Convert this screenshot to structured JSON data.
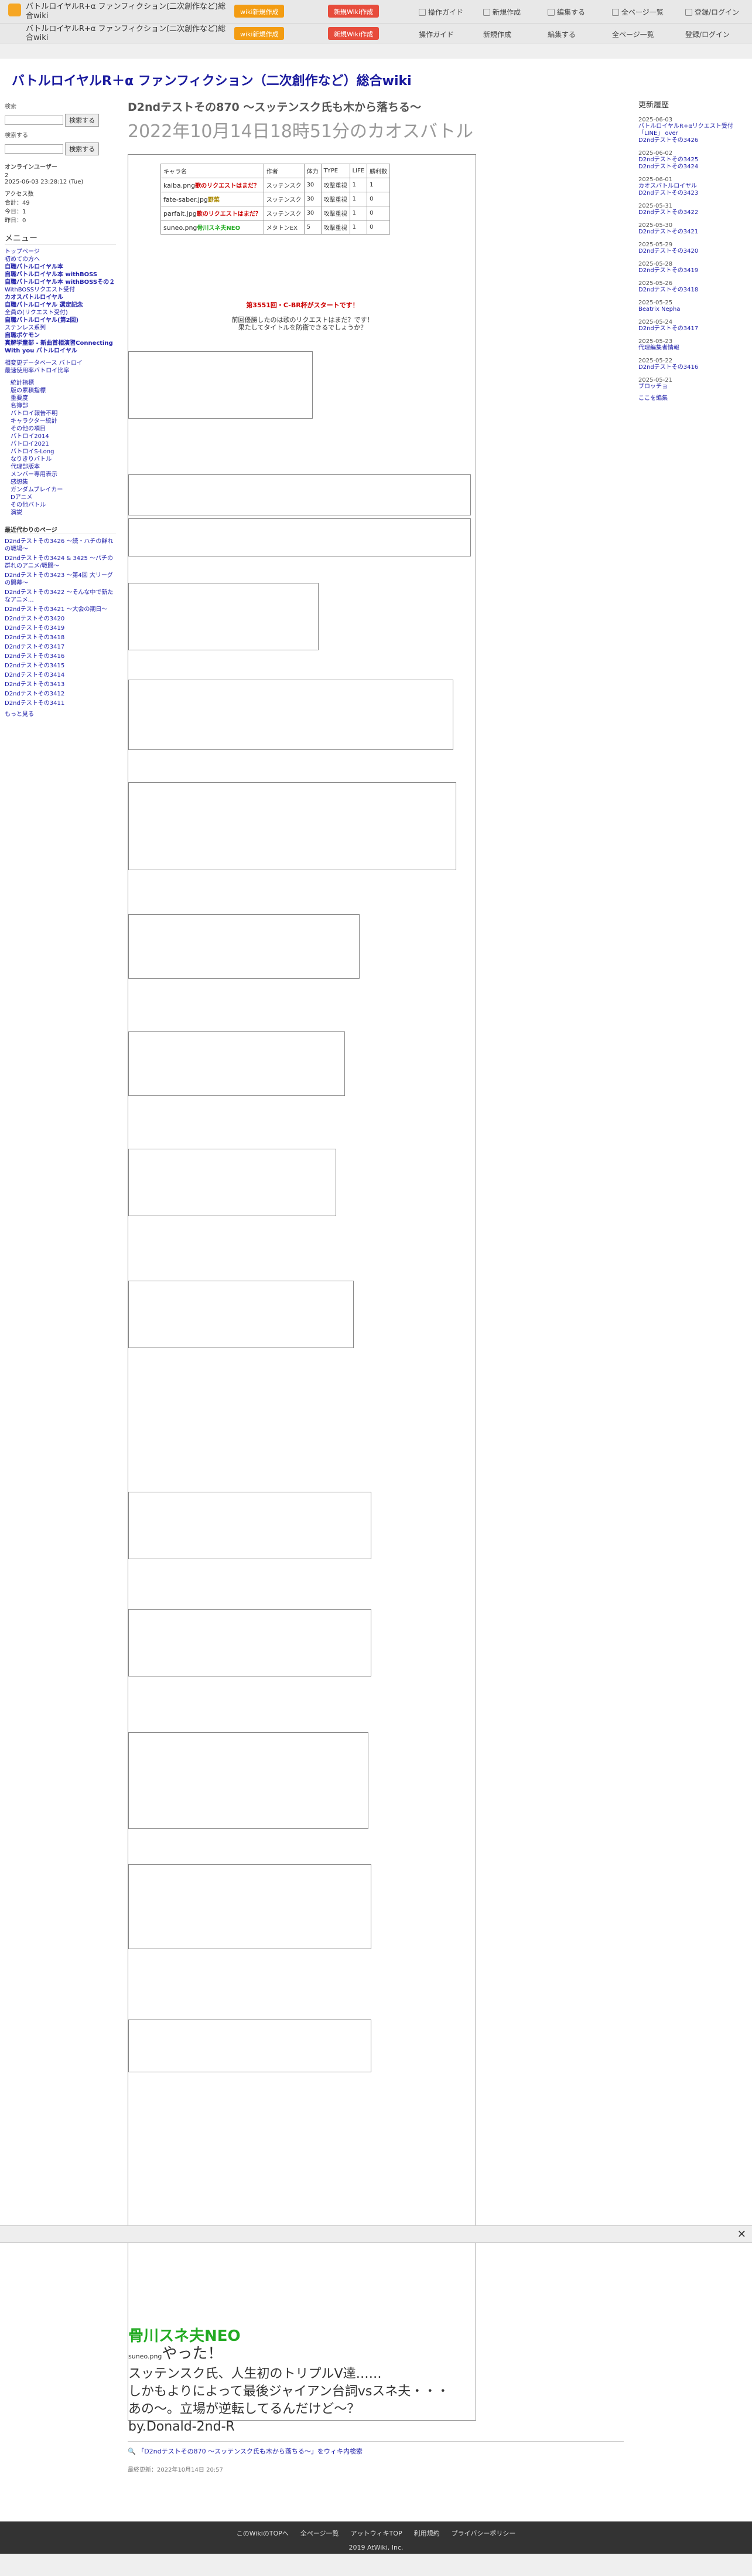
{
  "topbar": {
    "title": "バトルロイヤルR+α ファンフィクション(二次創作など)総合wiki",
    "wiki_create": "wiki新規作成",
    "reply_new": "新規Wiki作成",
    "items": [
      "操作ガイド",
      "新規作成",
      "編集する",
      "全ページ一覧",
      "登録/ログイン"
    ]
  },
  "header2": {
    "title": "バトルロイヤルR+α ファンフィクション(二次創作など)総合wiki"
  },
  "site_title": "バトルロイヤルR＋α ファンフィクション（二次創作など）総合wiki",
  "left": {
    "search_label": "検索",
    "search_btn": "検索する",
    "search2_label": "検索する",
    "online_label": "オンラインユーザー",
    "online_count": "2",
    "updated": "2025-06-03 23:28:12 (Tue)",
    "access_label": "アクセス数",
    "access": [
      "合計：49",
      "今日：1",
      "昨日：0"
    ],
    "menu_title": "メニュー",
    "menu": [
      {
        "t": "トップページ",
        "b": false
      },
      {
        "t": "初めての方へ",
        "b": false
      },
      {
        "t": "自職バトルロイヤル本",
        "b": true
      },
      {
        "t": "自職バトルロイヤル本 withBOSS",
        "b": true
      },
      {
        "t": "自職バトルロイヤル本 withBOSSその２",
        "b": true
      },
      {
        "t": "WithBOSSリクエスト受付",
        "b": false
      },
      {
        "t": "カオスバトルロイヤル",
        "b": true
      },
      {
        "t": "自職バトルロイヤル 選定記念",
        "b": true
      },
      {
        "t": "全員の(リクエスト受付)",
        "b": false
      },
      {
        "t": "自職バトルロイヤル(第2回)",
        "b": true
      },
      {
        "t": "ステンレス系列",
        "b": false
      },
      {
        "t": "自職ポケモン",
        "b": true
      },
      {
        "t": "真解学童部 - 新曲首相演習Connecting With you バトルロイヤル",
        "b": true
      }
    ],
    "meta": [
      "相変更データベース バトロイ",
      "最速使用率バトロイ比率"
    ],
    "menu2": [
      "統計指標",
      "版の累積指標",
      "重要度",
      "名簿部",
      "バトロイ報告不明",
      "キャラクター統計",
      "その他の項目",
      "バトロイ2014",
      "バトロイ2021",
      "バトロイS-Long",
      "なりきりバトル",
      "代理部版本",
      "メンバー専用表示",
      "感想集",
      "ガンダムブレイカー",
      "Dアニメ",
      "その他バトル",
      "演説"
    ],
    "edit_title": "最近代わりのページ",
    "edits": [
      "D2ndテストその3426 〜続・ハチの群れの戦場〜",
      "D2ndテストその3424 & 3425 〜パチの群れのアニメ/戦闘〜",
      "D2ndテストその3423 〜第4回 大リーグの開幕〜",
      "D2ndテストその3422 〜そんな中で新たなアニメ…",
      "D2ndテストその3421 〜大会の期日〜",
      "D2ndテストその3420",
      "D2ndテストその3419",
      "D2ndテストその3418",
      "D2ndテストその3417",
      "D2ndテストその3416",
      "D2ndテストその3415",
      "D2ndテストその3414",
      "D2ndテストその3413",
      "D2ndテストその3412",
      "D2ndテストその3411"
    ],
    "more": "もっと見る"
  },
  "main": {
    "page_title": "D2ndテストその870 〜スッテンスク氏も木から落ちる〜",
    "page_date": "2022年10月14日18時51分のカオスバトル",
    "table": {
      "headers": [
        "キャラ名",
        "作者",
        "体力",
        "TYPE",
        "LIFE",
        "勝利数"
      ],
      "rows": [
        [
          "歌のリクエストはまだ？",
          "スッテンスク",
          "30",
          "攻撃重視",
          "1",
          "1"
        ],
        [
          "野菜",
          "スッテンスク",
          "30",
          "攻撃重視",
          "1",
          "0"
        ],
        [
          "歌のリクエストはまだ？",
          "スッテンスク",
          "30",
          "攻撃重視",
          "1",
          "0"
        ],
        [
          "骨川スネ夫NEO",
          "メタトンEX",
          "5",
          "攻撃重視",
          "1",
          "0"
        ]
      ],
      "imgs": [
        "kaiba.png",
        "fate-saber.jpg",
        "parfait.jpg",
        "suneo.png"
      ]
    },
    "intro": [
      "第3551回・C-BR杯がスタートです！",
      "前回優勝したのは歌のリクエストはまだ？です！",
      "果たしてタイトルを防衛できるでしょうか？"
    ],
    "footer_line": "「D2ndテストその870 〜スッテンスク氏も木から落ちる〜」をウィキ内検索",
    "last_update": "最終更新：2022年10月14日 20:57"
  },
  "right": {
    "title": "更新履歴",
    "groups": [
      {
        "date": "2025-06-03",
        "items": [
          "バトルロイヤルR+αリクエスト受付「LINE」 over",
          "D2ndテストその3426"
        ]
      },
      {
        "date": "2025-06-02",
        "items": [
          "D2ndテストその3425",
          "D2ndテストその3424"
        ]
      },
      {
        "date": "2025-06-01",
        "items": [
          "カオスバトルロイヤル",
          "D2ndテストその3423"
        ]
      },
      {
        "date": "2025-05-31",
        "items": [
          "D2ndテストその3422"
        ]
      },
      {
        "date": "2025-05-30",
        "items": [
          "D2ndテストその3421"
        ]
      },
      {
        "date": "2025-05-29",
        "items": [
          "D2ndテストその3420"
        ]
      },
      {
        "date": "2025-05-28",
        "items": [
          "D2ndテストその3419"
        ]
      },
      {
        "date": "2025-05-26",
        "items": [
          "D2ndテストその3418"
        ]
      },
      {
        "date": "2025-05-25",
        "items": [
          "Beatrix Nepha"
        ]
      },
      {
        "date": "2025-05-24",
        "items": [
          "D2ndテストその3417"
        ]
      },
      {
        "date": "2025-05-23",
        "items": [
          "代理編集者情報"
        ]
      },
      {
        "date": "2025-05-22",
        "items": [
          "D2ndテストその3416"
        ]
      },
      {
        "date": "2025-05-21",
        "items": [
          "ブロッチョ"
        ]
      }
    ],
    "more": "ここを編集"
  },
  "footer": {
    "links": [
      "このWikiのTOPへ",
      "全ページ一覧",
      "アットウィキTOP",
      "利用規約",
      "プライバシーポリシー"
    ],
    "copy": "2019 AtWiki, Inc."
  },
  "story": {
    "final_big": [
      "骨川スネ夫NEO",
      "やった！",
      "スッテンスク氏、人生初のトリプルV達……",
      "しかもよりによって最後ジャイアン台詞vsスネ夫・・・",
      "あの〜。立場が逆転してるんだけど〜？",
      "by.Donald-2nd-R"
    ]
  }
}
